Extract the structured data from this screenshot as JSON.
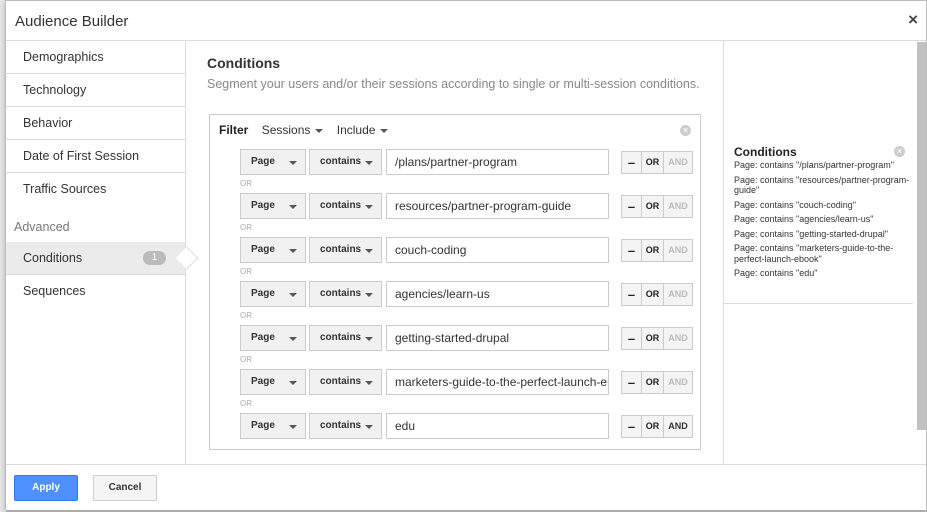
{
  "dialog": {
    "title": "Audience Builder",
    "close": "×"
  },
  "sidebar": {
    "items": [
      {
        "label": "Demographics"
      },
      {
        "label": "Technology"
      },
      {
        "label": "Behavior"
      },
      {
        "label": "Date of First Session"
      },
      {
        "label": "Traffic Sources"
      }
    ],
    "advanced_label": "Advanced",
    "conditions_label": "Conditions",
    "conditions_count": "1",
    "sequences_label": "Sequences"
  },
  "main": {
    "title": "Conditions",
    "subtitle": "Segment your users and/or their sessions according to single or multi-session conditions.",
    "filter": {
      "label": "Filter",
      "scope": "Sessions",
      "mode": "Include"
    },
    "or_separator": "OR",
    "rows": [
      {
        "dimension": "Page",
        "operator": "contains",
        "value": "/plans/partner-program",
        "minus": "–",
        "or": "OR",
        "and": "AND"
      },
      {
        "dimension": "Page",
        "operator": "contains",
        "value": "resources/partner-program-guide",
        "minus": "–",
        "or": "OR",
        "and": "AND"
      },
      {
        "dimension": "Page",
        "operator": "contains",
        "value": "couch-coding",
        "minus": "–",
        "or": "OR",
        "and": "AND"
      },
      {
        "dimension": "Page",
        "operator": "contains",
        "value": "agencies/learn-us",
        "minus": "–",
        "or": "OR",
        "and": "AND"
      },
      {
        "dimension": "Page",
        "operator": "contains",
        "value": "getting-started-drupal",
        "minus": "–",
        "or": "OR",
        "and": "AND"
      },
      {
        "dimension": "Page",
        "operator": "contains",
        "value": "marketers-guide-to-the-perfect-launch-el",
        "minus": "–",
        "or": "OR",
        "and": "AND"
      },
      {
        "dimension": "Page",
        "operator": "contains",
        "value": "edu",
        "minus": "–",
        "or": "OR",
        "and": "AND"
      }
    ]
  },
  "summary": {
    "title": "Conditions",
    "items": [
      "Page: contains \"/plans/partner-program\"",
      "Page: contains \"resources/partner-program-guide\"",
      "Page: contains \"couch-coding\"",
      "Page: contains \"agencies/learn-us\"",
      "Page: contains \"getting-started-drupal\"",
      "Page: contains \"marketers-guide-to-the-perfect-launch-ebook\"",
      "Page: contains \"edu\""
    ]
  },
  "footer": {
    "apply_label": "Apply",
    "cancel_label": "Cancel"
  },
  "colors": {
    "accent": "#4d90fe",
    "border": "#dcdcdc"
  }
}
